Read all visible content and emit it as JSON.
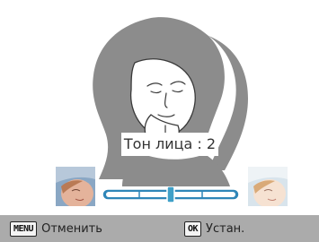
{
  "tone_label": "Тон лица : 2",
  "tone_level": {
    "value": 2,
    "min": 0,
    "max": 4
  },
  "preview_icons": {
    "portrait": "portrait-illustration-icon",
    "left_sample": "face-tone-light-icon",
    "right_sample": "face-tone-bright-icon"
  },
  "softkeys": {
    "cancel": {
      "key": "MENU",
      "label": "Отменить"
    },
    "ok": {
      "key": "OK",
      "label": "Устан."
    }
  },
  "colors": {
    "bar": "#ababab",
    "slider_handle": "#3fa0c8",
    "portrait_gray": "#8c8c8c"
  }
}
